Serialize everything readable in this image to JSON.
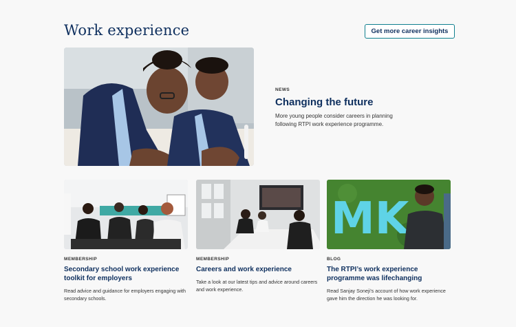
{
  "header": {
    "title": "Work experience",
    "cta_label": "Get more career insights"
  },
  "feature": {
    "tag": "News",
    "title": "Changing the future",
    "description": "More young people consider careers in planning following RTPI work experience programme."
  },
  "cards": [
    {
      "tag": "Membership",
      "title": "Secondary school work experience toolkit for employers",
      "description": "Read advice and guidance for employers engaging with secondary schools."
    },
    {
      "tag": "Membership",
      "title": "Careers and work experience",
      "description": "Take a look at our latest tips and advice around careers and work experience."
    },
    {
      "tag": "Blog",
      "title": "The RTPI’s work experience programme was lifechanging",
      "description": "Read Sanjay Soneji’s account of how work experience gave him the direction he was looking for."
    }
  ],
  "card3_sign_text": "MK",
  "colors": {
    "navy": "#0e2f5e",
    "teal_border": "#0e7f8e",
    "background": "#f8f8f8"
  }
}
